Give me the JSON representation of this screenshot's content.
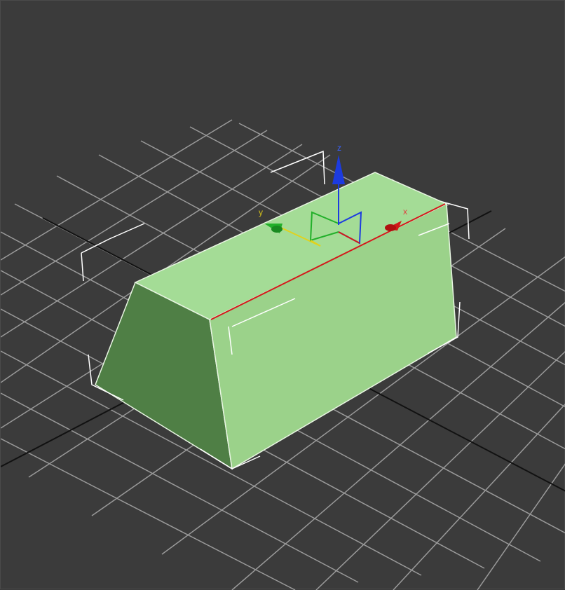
{
  "viewport": {
    "background": "#3b3b3b",
    "grid_color": "#9a9a9a",
    "grid_major_color": "#111111"
  },
  "object": {
    "shape": "trapezoidal-prism",
    "face_top": "#a4dc96",
    "face_front": "#9bd28a",
    "face_side": "#4f7f45",
    "edge_color": "#e8f5e2",
    "bbox_color": "#ffffff"
  },
  "gizmo": {
    "x_label": "x",
    "y_label": "y",
    "z_label": "z",
    "x_color": "#d11a1a",
    "y_color": "#22b02a",
    "z_color": "#1c3be0",
    "y_label_color": "#d6c21a",
    "x_label_color": "#e04040",
    "z_label_color": "#3a62ff",
    "plane_icon": "transform-gizmo-plane-icon"
  }
}
